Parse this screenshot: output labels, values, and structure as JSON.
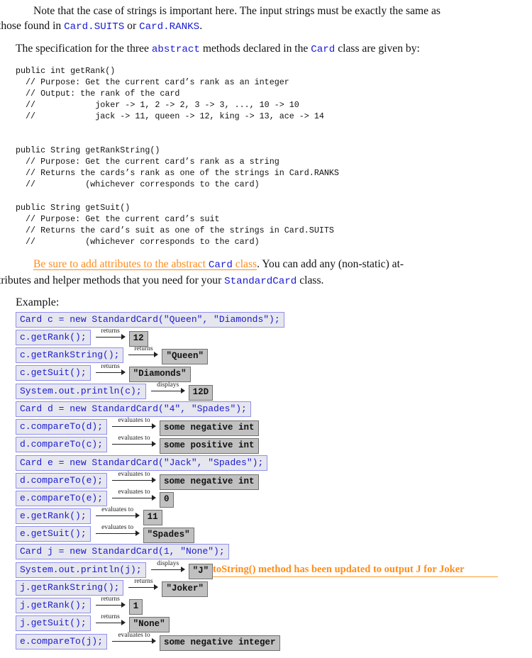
{
  "intro": {
    "line1": "Note that the case of strings is important here. The input strings must be exactly the same as",
    "line2_prefix": "those found in ",
    "suits_ref": "Card.SUITS",
    "or": " or ",
    "ranks_ref": "Card.RANKS",
    "period": "."
  },
  "spec": {
    "prefix": "The specification for the three ",
    "abstract": "abstract",
    "middle": " methods declared in the ",
    "card": "Card",
    "suffix": " class are given by:"
  },
  "code_blocks": [
    "public int getRank()\n  // Purpose: Get the current card’s rank as an integer\n  // Output: the rank of the card\n  //            joker -> 1, 2 -> 2, 3 -> 3, ..., 10 -> 10\n  //            jack -> 11, queen -> 12, king -> 13, ace -> 14",
    "public String getRankString()\n  // Purpose: Get the current card’s rank as a string\n  // Returns the cards’s rank as one of the strings in Card.RANKS\n  //          (whichever corresponds to the card)",
    "public String getSuit()\n  // Purpose: Get the current card’s suit\n  // Returns the card’s suit as one of the strings in Card.SUITS\n  //          (whichever corresponds to the card)"
  ],
  "reminder": {
    "highlight_prefix": "Be sure to add attributes to the abstract ",
    "highlight_card": "Card",
    "highlight_suffix": " class",
    "rest1": ". You can add any (non-static) at-",
    "rest2_prefix": "tributes and helper methods that you need for your ",
    "standard_card": "StandardCard",
    "rest2_suffix": " class."
  },
  "example": {
    "label": "Example:",
    "rows": [
      {
        "call": "Card c = new StandardCard(\"Queen\", \"Diamonds\");"
      },
      {
        "call": "c.getRank();",
        "verb": "returns",
        "result": "12"
      },
      {
        "call": "c.getRankString();",
        "verb": "returns",
        "result": "\"Queen\""
      },
      {
        "call": "c.getSuit();",
        "verb": "returns",
        "result": "\"Diamonds\""
      },
      {
        "call": "System.out.println(c);",
        "verb": "displays",
        "result": "12D"
      },
      {
        "call": "Card d = new StandardCard(\"4\", \"Spades\");"
      },
      {
        "call": "c.compareTo(d);",
        "verb": "evaluates to",
        "result": "some negative int"
      },
      {
        "call": "d.compareTo(c);",
        "verb": "evaluates to",
        "result": "some positive int"
      },
      {
        "call": "Card e = new StandardCard(\"Jack\", \"Spades\");"
      },
      {
        "call": "d.compareTo(e);",
        "verb": "evaluates to",
        "result": "some negative int"
      },
      {
        "call": "e.compareTo(e);",
        "verb": "evaluates to",
        "result": "0"
      },
      {
        "call": "e.getRank();",
        "verb": "evaluates to",
        "result": "11"
      },
      {
        "call": "e.getSuit();",
        "verb": "evaluates to",
        "result": "\"Spades\""
      },
      {
        "call": "Card j = new StandardCard(1, \"None\");"
      },
      {
        "call": "System.out.println(j);",
        "verb": "displays",
        "result": "\"J\""
      },
      {
        "call": "j.getRankString();",
        "verb": "returns",
        "result": "\"Joker\""
      },
      {
        "call": "j.getRank();",
        "verb": "returns",
        "result": "1"
      },
      {
        "call": "j.getSuit();",
        "verb": "returns",
        "result": "\"None\""
      },
      {
        "call": "e.compareTo(j);",
        "verb": "evaluates to",
        "result": "some negative integer"
      }
    ],
    "note": "toString() method has been updated to output J for Joker"
  }
}
